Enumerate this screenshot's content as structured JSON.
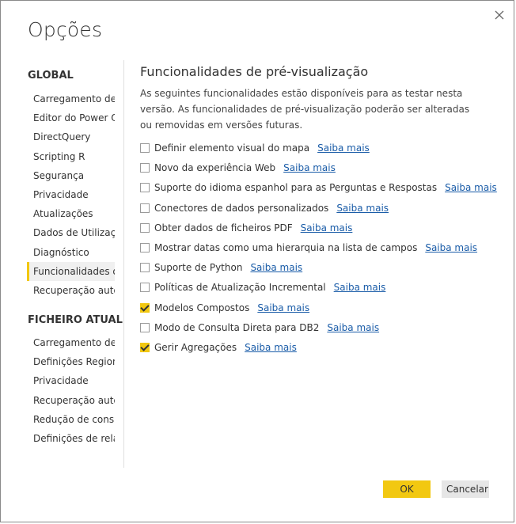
{
  "dialog": {
    "title": "Opções",
    "close_label": "×"
  },
  "sidebar": {
    "global_heading": "GLOBAL",
    "global_items": [
      {
        "label": "Carregamento de D"
      },
      {
        "label": "Editor do Power Qu"
      },
      {
        "label": "DirectQuery"
      },
      {
        "label": "Scripting R"
      },
      {
        "label": "Segurança"
      },
      {
        "label": "Privacidade"
      },
      {
        "label": "Atualizações"
      },
      {
        "label": "Dados de Utilizaçã"
      },
      {
        "label": "Diagnóstico"
      },
      {
        "label": "Funcionalidades de"
      },
      {
        "label": "Recuperação autom"
      }
    ],
    "active_item": "Funcionalidades de",
    "file_heading": "FICHEIRO ATUAL",
    "file_items": [
      {
        "label": "Carregamento de D"
      },
      {
        "label": "Definições Regional"
      },
      {
        "label": "Privacidade"
      },
      {
        "label": "Recuperação autom"
      },
      {
        "label": "Redução de consult"
      },
      {
        "label": "Definições de relató"
      }
    ]
  },
  "main": {
    "title": "Funcionalidades de pré-visualização",
    "description": "As seguintes funcionalidades estão disponíveis para as testar nesta versão. As funcionalidades de pré-visualização poderão ser alteradas ou removidas em versões futuras.",
    "features": [
      {
        "label": "Definir elemento visual do mapa",
        "link": "Saiba mais",
        "checked": false
      },
      {
        "label": "Novo da experiência Web",
        "link": "Saiba mais",
        "checked": false
      },
      {
        "label": "Suporte do idioma espanhol para as Perguntas e Respostas",
        "link": "Saiba mais",
        "checked": false
      },
      {
        "label": "Conectores de dados personalizados",
        "link": "Saiba mais",
        "checked": false
      },
      {
        "label": "Obter dados de ficheiros PDF",
        "link": "Saiba mais",
        "checked": false
      },
      {
        "label": "Mostrar datas como uma hierarquia na lista de campos",
        "link": "Saiba mais",
        "checked": false
      },
      {
        "label": "Suporte de Python",
        "link": "Saiba mais",
        "checked": false
      },
      {
        "label": "Políticas de Atualização Incremental",
        "link": "Saiba mais",
        "checked": false
      },
      {
        "label": "Modelos Compostos",
        "link": "Saiba mais",
        "checked": true
      },
      {
        "label": "Modo de Consulta Direta para DB2",
        "link": "Saiba mais",
        "checked": false
      },
      {
        "label": "Gerir Agregações",
        "link": "Saiba mais",
        "checked": true
      }
    ]
  },
  "buttons": {
    "ok": "OK",
    "cancel": "Cancelar"
  },
  "colors": {
    "accent": "#f2c811",
    "link": "#1a5ca8"
  }
}
